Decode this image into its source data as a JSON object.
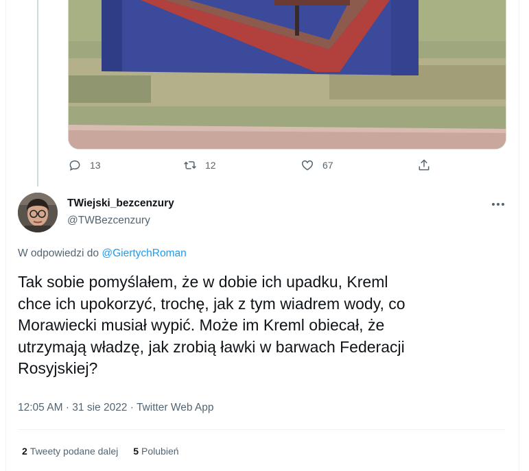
{
  "previous_tweet": {
    "actions": {
      "reply_count": "13",
      "retweet_count": "12",
      "like_count": "67"
    }
  },
  "reply": {
    "display_name": "TWiejski_bezcenzury",
    "handle": "@TWBezcenzury",
    "reply_prefix": "W odpowiedzi do ",
    "reply_target": "@GiertychRoman",
    "text": "Tak sobie pomyślałem, że w dobie ich upadku, Kreml\nchce ich upokorzyć, trochę, jak z tym wiadrem wody, co\nMorawiecki musiał wypić. Może im Kreml obiecał, że\nutrzymają władzę, jak zrobią ławki w barwach Federacji\nRosyjskiej?",
    "time": "12:05 AM",
    "date": "31 sie 2022",
    "source": "Twitter Web App",
    "separator": " · ",
    "stats": {
      "retweets_count": "2",
      "retweets_label": "Tweety podane dalej",
      "likes_count": "5",
      "likes_label": "Polubień"
    }
  },
  "icons": {
    "reply": "speech-bubble-icon",
    "retweet": "retweet-arrows-icon",
    "like": "heart-icon",
    "share": "share-upload-icon",
    "more": "more-dots-icon"
  },
  "colors": {
    "link": "#1d9bf0",
    "secondary_text": "#536471",
    "primary_text": "#0f1419"
  }
}
